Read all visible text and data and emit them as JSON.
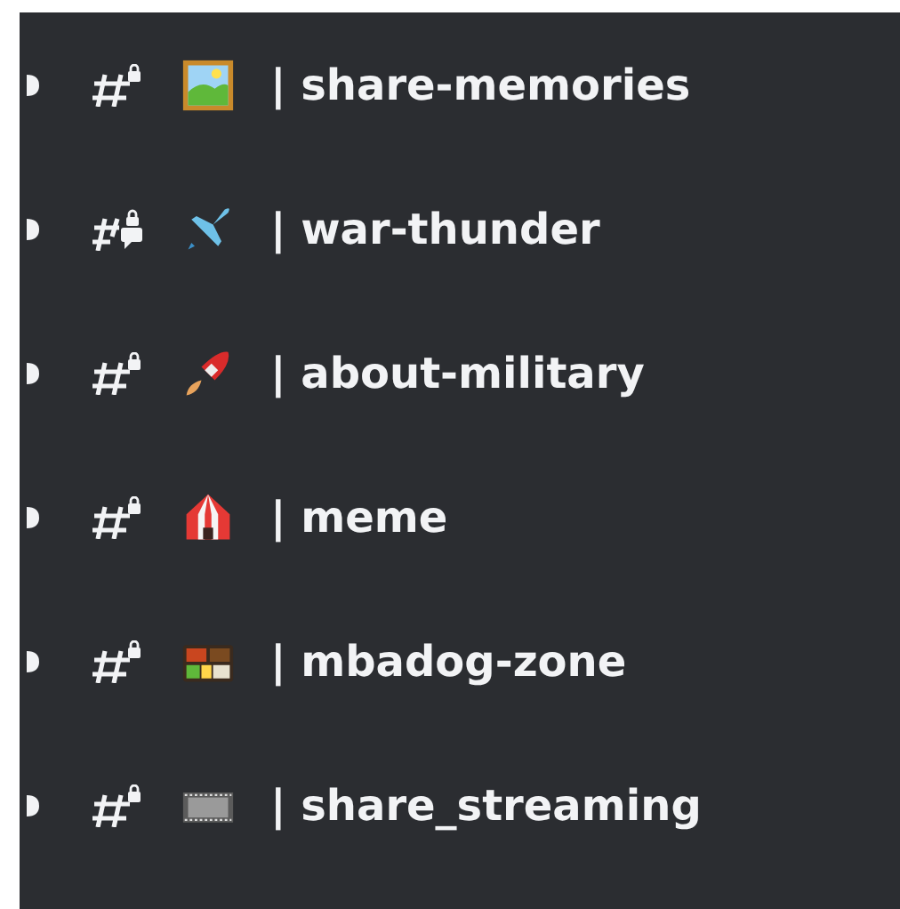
{
  "channels": [
    {
      "kind": "text",
      "name": "| share-memories"
    },
    {
      "kind": "forum",
      "name": "| war-thunder"
    },
    {
      "kind": "text",
      "name": "| about-military"
    },
    {
      "kind": "text",
      "name": "| meme"
    },
    {
      "kind": "text",
      "name": "| mbadog-zone"
    },
    {
      "kind": "text",
      "name": "| share_streaming"
    }
  ]
}
